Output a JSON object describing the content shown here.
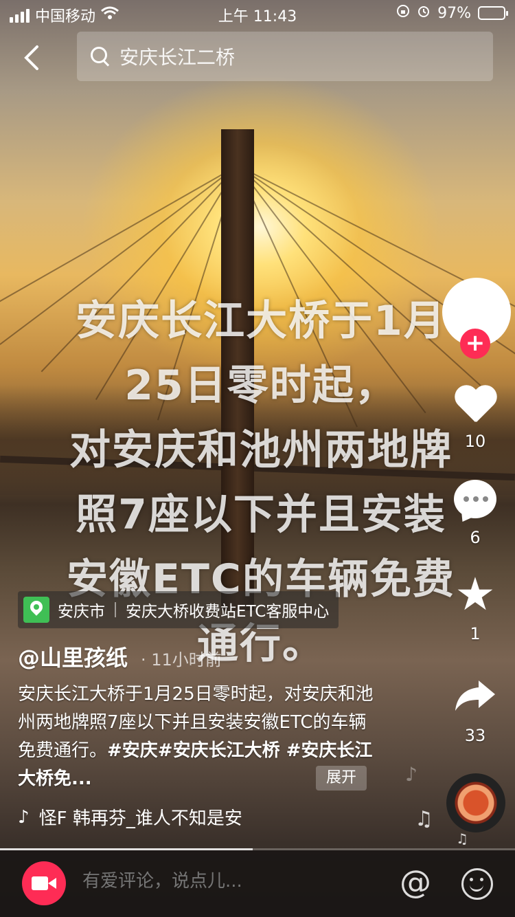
{
  "status_bar": {
    "carrier": "中国移动",
    "time": "上午 11:43",
    "battery": "97%"
  },
  "search": {
    "query": "安庆长江二桥"
  },
  "video": {
    "caption_lines": [
      "安庆长江大桥于1月",
      "25日零时起，",
      "对安庆和池州两地牌",
      "照7座以下并且安装",
      "安徽ETC的车辆免费",
      "通行。"
    ]
  },
  "actions": {
    "likes": "10",
    "comments": "6",
    "favorites": "1",
    "shares": "33"
  },
  "location": {
    "city": "安庆市",
    "place": "安庆大桥收费站ETC客服中心"
  },
  "post": {
    "author": "@山里孩纸",
    "time_ago": "· 11小时前",
    "description": "安庆长江大桥于1月25日零时起，对安庆和池州两地牌照7座以下并且安装安徽ETC的车辆免费通行。",
    "tags": "#安庆#安庆长江大桥 #安庆长江大桥免...",
    "expand_label": "展开"
  },
  "music": {
    "title": "怪F    韩再芬_谁人不知是安"
  },
  "bottom_bar": {
    "comment_placeholder": "有爱评论，说点儿..."
  },
  "colors": {
    "accent": "#fe2c55",
    "location_green": "#3fbf55"
  }
}
